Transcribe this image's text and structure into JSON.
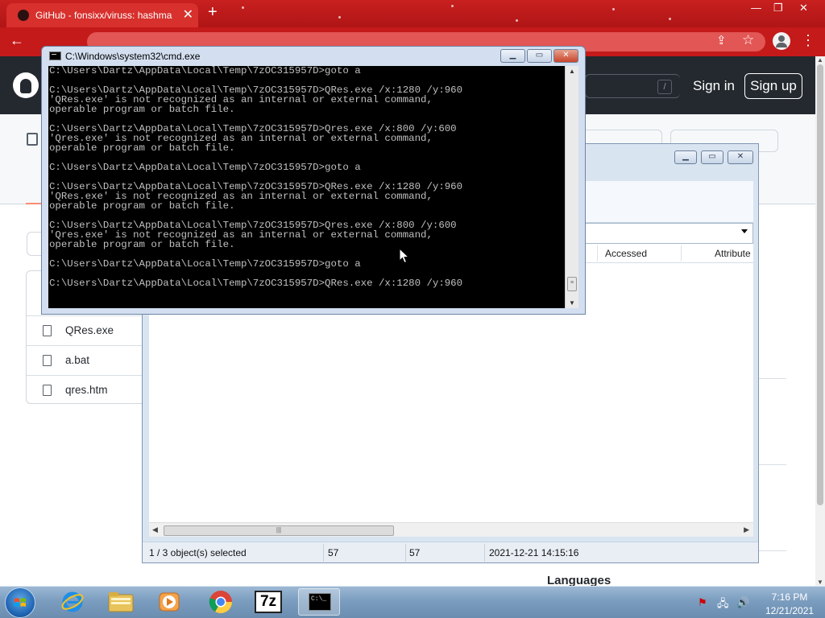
{
  "browser": {
    "tab_title": "GitHub - fonsixx/viruss: hashma",
    "tab_close": "✕",
    "new_tab": "+",
    "window_controls": {
      "minimize": "—",
      "restore": "❐",
      "close": "✕"
    },
    "back": "←",
    "menu": "⋮",
    "icons": [
      "back-arrow-icon",
      "share-icon",
      "star-icon",
      "profile-icon",
      "menu-icon"
    ],
    "theme_color": "#c41a1a"
  },
  "github": {
    "search_slash": "/",
    "sign_in": "Sign in",
    "sign_up": "Sign up",
    "files": [
      {
        "name": "QRes.exe"
      },
      {
        "name": "a.bat"
      },
      {
        "name": "qres.htm"
      }
    ],
    "languages_heading": "Languages",
    "header_color": "#24292f"
  },
  "cmd": {
    "title": "C:\\Windows\\system32\\cmd.exe",
    "buttons": {
      "minimize": "▁",
      "maximize": "▭",
      "close": "✕"
    },
    "lines": [
      "C:\\Users\\Dartz\\AppData\\Local\\Temp\\7zOC315957D>goto a",
      "",
      "C:\\Users\\Dartz\\AppData\\Local\\Temp\\7zOC315957D>QRes.exe /x:1280 /y:960",
      "'QRes.exe' is not recognized as an internal or external command,",
      "operable program or batch file.",
      "",
      "C:\\Users\\Dartz\\AppData\\Local\\Temp\\7zOC315957D>Qres.exe /x:800 /y:600",
      "'Qres.exe' is not recognized as an internal or external command,",
      "operable program or batch file.",
      "",
      "C:\\Users\\Dartz\\AppData\\Local\\Temp\\7zOC315957D>goto a",
      "",
      "C:\\Users\\Dartz\\AppData\\Local\\Temp\\7zOC315957D>QRes.exe /x:1280 /y:960",
      "'QRes.exe' is not recognized as an internal or external command,",
      "operable program or batch file.",
      "",
      "C:\\Users\\Dartz\\AppData\\Local\\Temp\\7zOC315957D>Qres.exe /x:800 /y:600",
      "'Qres.exe' is not recognized as an internal or external command,",
      "operable program or batch file.",
      "",
      "C:\\Users\\Dartz\\AppData\\Local\\Temp\\7zOC315957D>goto a",
      "",
      "C:\\Users\\Dartz\\AppData\\Local\\Temp\\7zOC315957D>QRes.exe /x:1280 /y:960"
    ]
  },
  "explorer": {
    "buttons": {
      "minimize": "▁",
      "maximize": "▭",
      "close": "✕"
    },
    "columns": [
      "Accessed",
      "Attribute"
    ],
    "status": {
      "selection": "1 / 3 object(s) selected",
      "size": "57",
      "packed_size": "57",
      "modified": "2021-12-21 14:15:16"
    }
  },
  "taskbar": {
    "items": [
      "start-orb",
      "internet-explorer",
      "file-explorer",
      "media-player",
      "chrome",
      "7-zip",
      "command-prompt"
    ],
    "active_item": "command-prompt",
    "sevenzip_label": "7z",
    "cmd_label": "C:\\_",
    "time": "7:16 PM",
    "date": "12/21/2021"
  }
}
